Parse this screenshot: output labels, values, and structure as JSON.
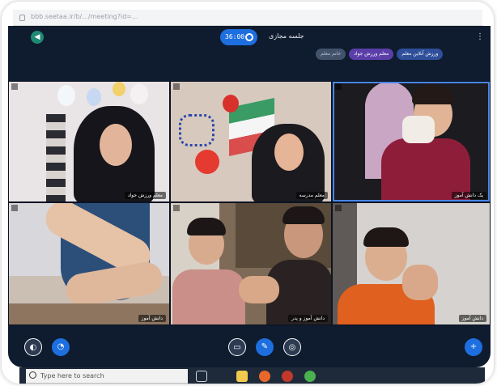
{
  "browser": {
    "url": "bbb.seetaa.ir/b/.../meeting?id=..."
  },
  "topbar": {
    "session_time": "36:00",
    "meeting_title": "جلسه مجازی",
    "presenters": [
      "خانم معلم",
      "معلم ورزش جواد",
      "ورزش آنلاین معلم"
    ]
  },
  "tiles": [
    {
      "name": "معلم ورزش جواد"
    },
    {
      "name": "معلم مدرسه"
    },
    {
      "name": "یک دانش آموز"
    },
    {
      "name": "دانش آموز"
    },
    {
      "name": "دانش آموز و پدر"
    },
    {
      "name": "دانش آموز"
    }
  ],
  "taskbar": {
    "search_placeholder": "Type here to search"
  },
  "colors": {
    "app_background": "#0f1b2e",
    "accent": "#1d6fe0"
  }
}
